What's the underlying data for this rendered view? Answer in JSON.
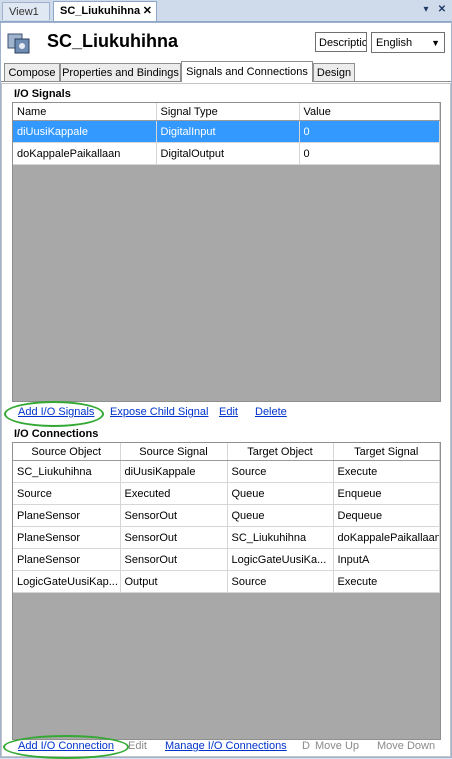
{
  "doc_tabs": {
    "view1": "View1",
    "active": "SC_Liukuhihna",
    "close": "✕"
  },
  "strip": {
    "dropdown": "▾",
    "close": "✕"
  },
  "header": {
    "title": "SC_Liukuhihna",
    "description_btn": "Descriptic",
    "language": "English"
  },
  "tabs": [
    "Compose",
    "Properties and Bindings",
    "Signals and Connections",
    "Design"
  ],
  "io_signals": {
    "title": "I/O Signals",
    "columns": [
      "Name",
      "Signal Type",
      "Value"
    ],
    "rows": [
      [
        "diUusiKappale",
        "DigitalInput",
        "0"
      ],
      [
        "doKappalePaikallaan",
        "DigitalOutput",
        "0"
      ]
    ],
    "actions": [
      "Add I/O Signals",
      "Expose Child Signal",
      "Edit",
      "Delete"
    ]
  },
  "io_connections": {
    "title": "I/O Connections",
    "columns": [
      "Source Object",
      "Source Signal",
      "Target Object",
      "Target Signal"
    ],
    "rows": [
      [
        "SC_Liukuhihna",
        "diUusiKappale",
        "Source",
        "Execute"
      ],
      [
        "Source",
        "Executed",
        "Queue",
        "Enqueue"
      ],
      [
        "PlaneSensor",
        "SensorOut",
        "Queue",
        "Dequeue"
      ],
      [
        "PlaneSensor",
        "SensorOut",
        "SC_Liukuhihna",
        "doKappalePaikallaan"
      ],
      [
        "PlaneSensor",
        "SensorOut",
        "LogicGateUusiKa...",
        "InputA"
      ],
      [
        "LogicGateUusiKap...",
        "Output",
        "Source",
        "Execute"
      ]
    ],
    "actions": [
      "Add I/O Connection",
      "Edit",
      "Manage I/O Connections",
      "D",
      "Move Up",
      "Move Down"
    ]
  },
  "colors": {
    "selection": "#3399ff",
    "link": "#0033cc",
    "highlight_ring": "#33a833",
    "grid_empty": "#a8a8a8"
  }
}
